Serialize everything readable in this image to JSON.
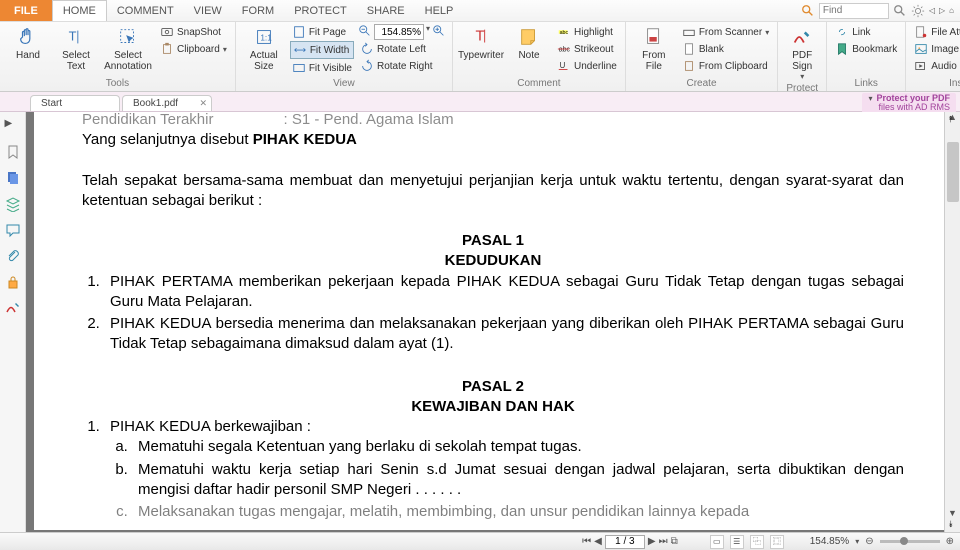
{
  "menu": {
    "file": "FILE",
    "tabs": [
      "HOME",
      "COMMENT",
      "VIEW",
      "FORM",
      "PROTECT",
      "SHARE",
      "HELP"
    ],
    "active": 0,
    "find_placeholder": "Find"
  },
  "ribbon": {
    "tools": {
      "label": "Tools",
      "hand": "Hand",
      "select_text": "Select\nText",
      "select_ann": "Select\nAnnotation",
      "snapshot": "SnapShot",
      "clipboard": "Clipboard"
    },
    "view": {
      "label": "View",
      "actual": "Actual\nSize",
      "fit_page": "Fit Page",
      "fit_width": "Fit Width",
      "fit_visible": "Fit Visible",
      "zoom": "154.85%",
      "rot_left": "Rotate Left",
      "rot_right": "Rotate Right"
    },
    "comment": {
      "label": "Comment",
      "typewriter": "Typewriter",
      "note": "Note",
      "highlight": "Highlight",
      "strikeout": "Strikeout",
      "underline": "Underline"
    },
    "create": {
      "label": "Create",
      "from_file": "From\nFile",
      "from_scanner": "From Scanner",
      "blank": "Blank",
      "from_clipboard": "From Clipboard"
    },
    "protect": {
      "label": "Protect",
      "pdf_sign": "PDF\nSign"
    },
    "links": {
      "label": "Links",
      "link": "Link",
      "bookmark": "Bookmark"
    },
    "insert": {
      "label": "Insert",
      "file_att": "File Attachment",
      "img_ann": "Image Annotation",
      "av": "Audio & Video"
    }
  },
  "doctabs": {
    "t1": "Start",
    "t2": "Book1.pdf"
  },
  "ad": {
    "l1": "Protect your PDF",
    "l2": "files with AD RMS"
  },
  "document": {
    "line_top1": "Pendidikan Terakhir",
    "line_top2": ":    S1 - Pend. Agama Islam",
    "line2a": "Yang selanjutnya disebut ",
    "line2b": "PIHAK KEDUA",
    "para1": "Telah sepakat bersama-sama membuat dan menyetujui perjanjian kerja untuk waktu tertentu, dengan syarat-syarat dan ketentuan sebagai berikut :",
    "p1_title": "PASAL 1",
    "p1_sub": "KEDUDUKAN",
    "p1_li1": "PIHAK PERTAMA memberikan pekerjaan kepada PIHAK KEDUA sebagai Guru Tidak Tetap dengan tugas sebagai Guru Mata Pelajaran.",
    "p1_li2": "PIHAK KEDUA bersedia menerima dan melaksanakan pekerjaan yang diberikan oleh PIHAK PERTAMA sebagai Guru Tidak Tetap sebagaimana dimaksud dalam ayat (1).",
    "p2_title": "PASAL 2",
    "p2_sub": "KEWAJIBAN DAN HAK",
    "p2_li1": "PIHAK KEDUA berkewajiban :",
    "p2_a": "Mematuhi segala Ketentuan yang berlaku di sekolah tempat tugas.",
    "p2_b": "Mematuhi waktu kerja setiap hari Senin s.d Jumat sesuai dengan jadwal pelajaran, serta dibuktikan dengan mengisi daftar hadir personil SMP Negeri    . . . . . .",
    "p2_c": "Melaksanakan tugas mengajar, melatih, membimbing, dan unsur pendidikan lainnya kepada"
  },
  "status": {
    "page": "1 / 3",
    "zoom": "154.85%"
  }
}
